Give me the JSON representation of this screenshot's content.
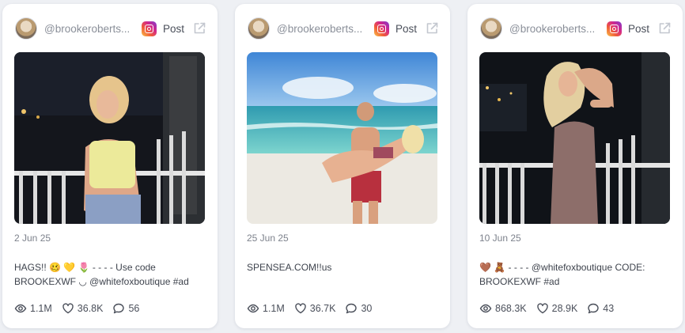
{
  "posts": [
    {
      "handle": "@brookeroberts...",
      "platform_label": "Post",
      "date": "2 Jun 25",
      "caption": "HAGS!! 🥴 💛 🌷 - - - - Use code BROOKEXWF ◡ @whitefoxboutique #ad",
      "views": "1.1M",
      "likes": "36.8K",
      "comments": "56"
    },
    {
      "handle": "@brookeroberts...",
      "platform_label": "Post",
      "date": "25 Jun 25",
      "caption": "SPENSEA.COM!!us",
      "views": "1.1M",
      "likes": "36.7K",
      "comments": "30"
    },
    {
      "handle": "@brookeroberts...",
      "platform_label": "Post",
      "date": "10 Jun 25",
      "caption": "🤎 🧸 - - - - @whitefoxboutique CODE: BROOKEXWF #ad",
      "views": "868.3K",
      "likes": "28.9K",
      "comments": "43"
    }
  ],
  "icons": {
    "platform": "instagram-icon",
    "open": "external-link-icon",
    "views": "eye-icon",
    "likes": "heart-icon",
    "comments": "comment-icon"
  },
  "colors": {
    "background": "#eef0f4",
    "card": "#ffffff",
    "muted_text": "#8a8f99"
  }
}
